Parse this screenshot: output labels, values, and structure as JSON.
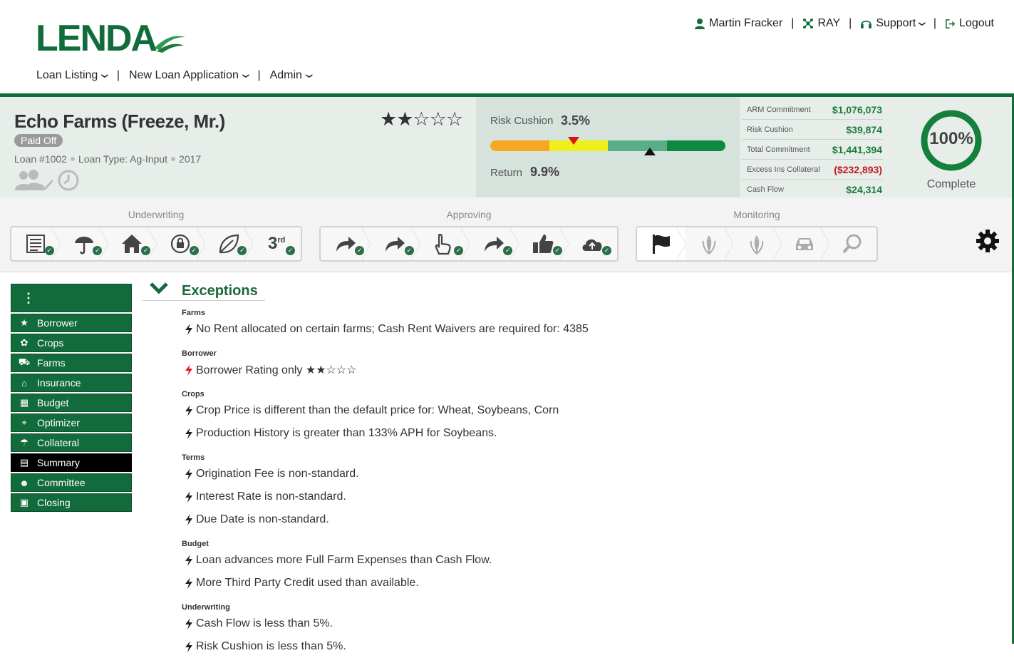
{
  "brand": {
    "logo_text": "LENDA",
    "green": "#126b3a"
  },
  "nav": {
    "items": [
      "Loan Listing",
      "New Loan Application",
      "Admin"
    ],
    "separator": "|"
  },
  "user_nav": {
    "user": "Martin Fracker",
    "ray": "RAY",
    "support": "Support",
    "logout": "Logout",
    "separator": "|"
  },
  "loan": {
    "title": "Echo Farms (Freeze, Mr.)",
    "status": "Paid Off",
    "loan_number": "Loan #1002",
    "loan_type": "Loan Type: Ag-Input",
    "year": "2017",
    "stars": "★★☆☆☆",
    "rating": 2
  },
  "risk": {
    "risk_cushion_label": "Risk Cushion",
    "risk_cushion_value": "3.5%",
    "return_label": "Return",
    "return_value": "9.9%",
    "bar_colors": [
      "#f7a823",
      "#f1ef1a",
      "#5aae87",
      "#0e8a3e"
    ]
  },
  "financials": [
    {
      "label": "ARM Commitment",
      "value": "$1,076,073",
      "negative": false
    },
    {
      "label": "Risk Cushion",
      "value": "$39,874",
      "negative": false
    },
    {
      "label": "Total Commitment",
      "value": "$1,441,394",
      "negative": false
    },
    {
      "label": "Excess Ins Collateral",
      "value": "($232,893)",
      "negative": true
    },
    {
      "label": "Cash Flow",
      "value": "$24,314",
      "negative": false
    }
  ],
  "completion": {
    "percent_text": "100%",
    "percent": 100,
    "label": "Complete"
  },
  "workflow": {
    "underwriting": {
      "title": "Underwriting",
      "steps": [
        "checklist-icon",
        "umbrella-icon",
        "home-icon",
        "lock-refresh-icon",
        "leaf-icon",
        "third-icon"
      ]
    },
    "approving": {
      "title": "Approving",
      "steps": [
        "forward-arrow-icon",
        "forward-arrow-icon",
        "hand-pointer-icon",
        "forward-arrow-icon",
        "thumbs-up-icon",
        "cloud-upload-icon"
      ]
    },
    "monitoring": {
      "title": "Monitoring",
      "steps": [
        "flag-icon",
        "corn-icon",
        "corn-icon",
        "car-icon",
        "search-icon"
      ]
    },
    "third_label": "rd"
  },
  "sidebar": {
    "menu_icon": "⋮",
    "items": [
      {
        "label": "Borrower",
        "icon": "star-icon",
        "glyph": "★"
      },
      {
        "label": "Crops",
        "icon": "plant-icon",
        "glyph": "✿"
      },
      {
        "label": "Farms",
        "icon": "tractor-icon",
        "glyph": "⛟"
      },
      {
        "label": "Insurance",
        "icon": "institution-icon",
        "glyph": "⌂"
      },
      {
        "label": "Budget",
        "icon": "calculator-icon",
        "glyph": "▦"
      },
      {
        "label": "Optimizer",
        "icon": "crosshair-icon",
        "glyph": "⌖"
      },
      {
        "label": "Collateral",
        "icon": "umbrella-icon",
        "glyph": "☂"
      },
      {
        "label": "Summary",
        "icon": "money-icon",
        "glyph": "▤"
      },
      {
        "label": "Committee",
        "icon": "users-icon",
        "glyph": "☻"
      },
      {
        "label": "Closing",
        "icon": "briefcase-icon",
        "glyph": "▣"
      }
    ],
    "active": "Summary"
  },
  "exceptions": {
    "title": "Exceptions",
    "groups": [
      {
        "category": "Farms",
        "items": [
          {
            "text": "No Rent allocated on certain farms; Cash Rent Waivers are required for: 4385",
            "level": "normal"
          }
        ]
      },
      {
        "category": "Borrower",
        "items": [
          {
            "text": "Borrower Rating only ★★☆☆☆",
            "level": "high"
          }
        ]
      },
      {
        "category": "Crops",
        "items": [
          {
            "text": "Crop Price is different than the default price for: Wheat, Soybeans, Corn",
            "level": "normal"
          },
          {
            "text": "Production History is greater than 133% APH for Soybeans.",
            "level": "normal"
          }
        ]
      },
      {
        "category": "Terms",
        "items": [
          {
            "text": "Origination Fee is non-standard.",
            "level": "normal"
          },
          {
            "text": "Interest Rate is non-standard.",
            "level": "normal"
          },
          {
            "text": "Due Date is non-standard.",
            "level": "normal"
          }
        ]
      },
      {
        "category": "Budget",
        "items": [
          {
            "text": "Loan advances more Full Farm Expenses than Cash Flow.",
            "level": "normal"
          },
          {
            "text": "More Third Party Credit used than available.",
            "level": "normal"
          }
        ]
      },
      {
        "category": "Underwriting",
        "items": [
          {
            "text": "Cash Flow is less than 5%.",
            "level": "normal"
          },
          {
            "text": "Risk Cushion is less than 5%.",
            "level": "normal"
          }
        ]
      }
    ]
  }
}
